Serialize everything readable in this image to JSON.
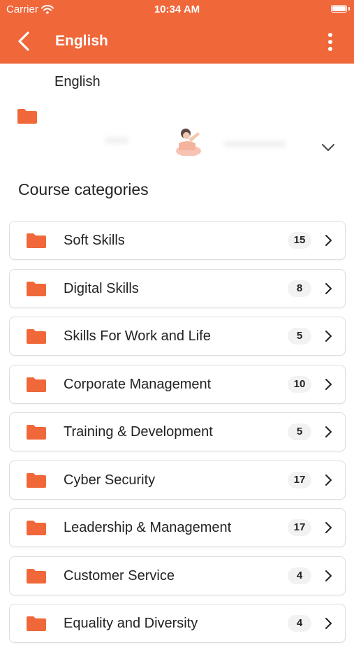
{
  "status_bar": {
    "carrier": "Carrier",
    "time": "10:34 AM"
  },
  "nav": {
    "title": "English"
  },
  "header": {
    "subtitle": "English"
  },
  "section": {
    "title": "Course categories"
  },
  "categories": [
    {
      "label": "Soft Skills",
      "count": "15"
    },
    {
      "label": "Digital Skills",
      "count": "8"
    },
    {
      "label": "Skills For Work and Life",
      "count": "5"
    },
    {
      "label": "Corporate Management",
      "count": "10"
    },
    {
      "label": "Training & Development",
      "count": "5"
    },
    {
      "label": "Cyber Security",
      "count": "17"
    },
    {
      "label": "Leadership & Management",
      "count": "17"
    },
    {
      "label": "Customer Service",
      "count": "4"
    },
    {
      "label": "Equality and Diversity",
      "count": "4"
    }
  ],
  "colors": {
    "accent": "#F0673A"
  },
  "icons": [
    "wifi-icon",
    "battery-icon",
    "back-icon",
    "more-icon",
    "folder-icon",
    "chevron-down-icon",
    "chevron-right-icon"
  ]
}
